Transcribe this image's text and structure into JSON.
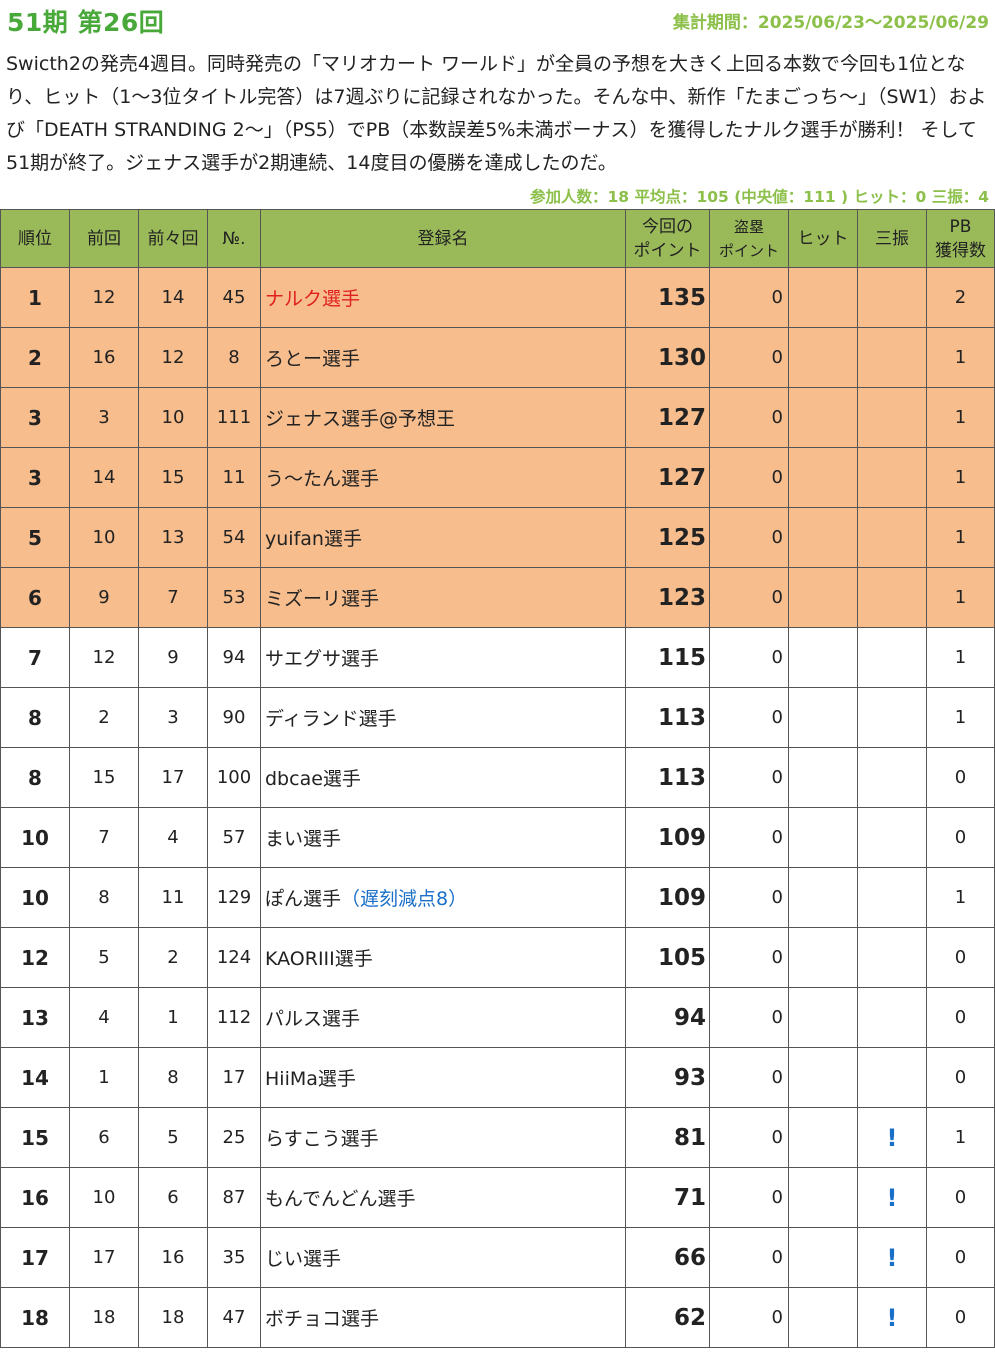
{
  "header": {
    "title": "51期 第26回",
    "period": "集計期間：2025/06/23～2025/06/29"
  },
  "description": "Swicth2の発売4週目。同時発売の「マリオカート ワールド」が全員の予想を大きく上回る本数で今回も1位となり、ヒット（1～3位タイトル完答）は7週ぶりに記録されなかった。そんな中、新作「たまごっち～」（SW1）および「DEATH STRANDING 2～」（PS5）でPB（本数誤差5%未満ボーナス）を獲得したナルク選手が勝利！ そして51期が終了。ジェナス選手が2期連続、14度目の優勝を達成したのだ。",
  "stats": "参加人数：18 平均点：105 (中央値：111 ) ヒット：0 三振：4",
  "columns": {
    "rank": "順位",
    "prev": "前回",
    "prev2": "前々回",
    "no": "№.",
    "name": "登録名",
    "points_line1": "今回の",
    "points_line2": "ポイント",
    "steal_line1": "盗塁",
    "steal_line2": "ポイント",
    "hit": "ヒット",
    "strikeout": "三振",
    "pb_line1": "PB",
    "pb_line2": "獲得数"
  },
  "strikeout_mark": "!",
  "rows": [
    {
      "rank": "1",
      "prev": "12",
      "prev2": "14",
      "no": "45",
      "name": "ナルク選手",
      "penalty": "",
      "points": "135",
      "steal": "0",
      "hit": "",
      "strikeout": "",
      "pb": "2",
      "top": true,
      "winner": true
    },
    {
      "rank": "2",
      "prev": "16",
      "prev2": "12",
      "no": "8",
      "name": "ろとー選手",
      "penalty": "",
      "points": "130",
      "steal": "0",
      "hit": "",
      "strikeout": "",
      "pb": "1",
      "top": true
    },
    {
      "rank": "3",
      "prev": "3",
      "prev2": "10",
      "no": "111",
      "name": "ジェナス選手@予想王",
      "penalty": "",
      "points": "127",
      "steal": "0",
      "hit": "",
      "strikeout": "",
      "pb": "1",
      "top": true
    },
    {
      "rank": "3",
      "prev": "14",
      "prev2": "15",
      "no": "11",
      "name": "う～たん選手",
      "penalty": "",
      "points": "127",
      "steal": "0",
      "hit": "",
      "strikeout": "",
      "pb": "1",
      "top": true
    },
    {
      "rank": "5",
      "prev": "10",
      "prev2": "13",
      "no": "54",
      "name": "yuifan選手",
      "penalty": "",
      "points": "125",
      "steal": "0",
      "hit": "",
      "strikeout": "",
      "pb": "1",
      "top": true
    },
    {
      "rank": "6",
      "prev": "9",
      "prev2": "7",
      "no": "53",
      "name": "ミズーリ選手",
      "penalty": "",
      "points": "123",
      "steal": "0",
      "hit": "",
      "strikeout": "",
      "pb": "1",
      "top": true
    },
    {
      "rank": "7",
      "prev": "12",
      "prev2": "9",
      "no": "94",
      "name": "サエグサ選手",
      "penalty": "",
      "points": "115",
      "steal": "0",
      "hit": "",
      "strikeout": "",
      "pb": "1"
    },
    {
      "rank": "8",
      "prev": "2",
      "prev2": "3",
      "no": "90",
      "name": "ディランド選手",
      "penalty": "",
      "points": "113",
      "steal": "0",
      "hit": "",
      "strikeout": "",
      "pb": "1"
    },
    {
      "rank": "8",
      "prev": "15",
      "prev2": "17",
      "no": "100",
      "name": "dbcae選手",
      "penalty": "",
      "points": "113",
      "steal": "0",
      "hit": "",
      "strikeout": "",
      "pb": "0"
    },
    {
      "rank": "10",
      "prev": "7",
      "prev2": "4",
      "no": "57",
      "name": "まい選手",
      "penalty": "",
      "points": "109",
      "steal": "0",
      "hit": "",
      "strikeout": "",
      "pb": "0"
    },
    {
      "rank": "10",
      "prev": "8",
      "prev2": "11",
      "no": "129",
      "name": "ぽん選手",
      "penalty": "（遅刻減点8）",
      "points": "109",
      "steal": "0",
      "hit": "",
      "strikeout": "",
      "pb": "1"
    },
    {
      "rank": "12",
      "prev": "5",
      "prev2": "2",
      "no": "124",
      "name": "KAORIII選手",
      "penalty": "",
      "points": "105",
      "steal": "0",
      "hit": "",
      "strikeout": "",
      "pb": "0"
    },
    {
      "rank": "13",
      "prev": "4",
      "prev2": "1",
      "no": "112",
      "name": "パルス選手",
      "penalty": "",
      "points": "94",
      "steal": "0",
      "hit": "",
      "strikeout": "",
      "pb": "0"
    },
    {
      "rank": "14",
      "prev": "1",
      "prev2": "8",
      "no": "17",
      "name": "HiiMa選手",
      "penalty": "",
      "points": "93",
      "steal": "0",
      "hit": "",
      "strikeout": "",
      "pb": "0"
    },
    {
      "rank": "15",
      "prev": "6",
      "prev2": "5",
      "no": "25",
      "name": "らすこう選手",
      "penalty": "",
      "points": "81",
      "steal": "0",
      "hit": "",
      "strikeout": "!",
      "pb": "1"
    },
    {
      "rank": "16",
      "prev": "10",
      "prev2": "6",
      "no": "87",
      "name": "もんでんどん選手",
      "penalty": "",
      "points": "71",
      "steal": "0",
      "hit": "",
      "strikeout": "!",
      "pb": "0"
    },
    {
      "rank": "17",
      "prev": "17",
      "prev2": "16",
      "no": "35",
      "name": "じい選手",
      "penalty": "",
      "points": "66",
      "steal": "0",
      "hit": "",
      "strikeout": "!",
      "pb": "0"
    },
    {
      "rank": "18",
      "prev": "18",
      "prev2": "18",
      "no": "47",
      "name": "ボチョコ選手",
      "penalty": "",
      "points": "62",
      "steal": "0",
      "hit": "",
      "strikeout": "!",
      "pb": "0"
    }
  ]
}
